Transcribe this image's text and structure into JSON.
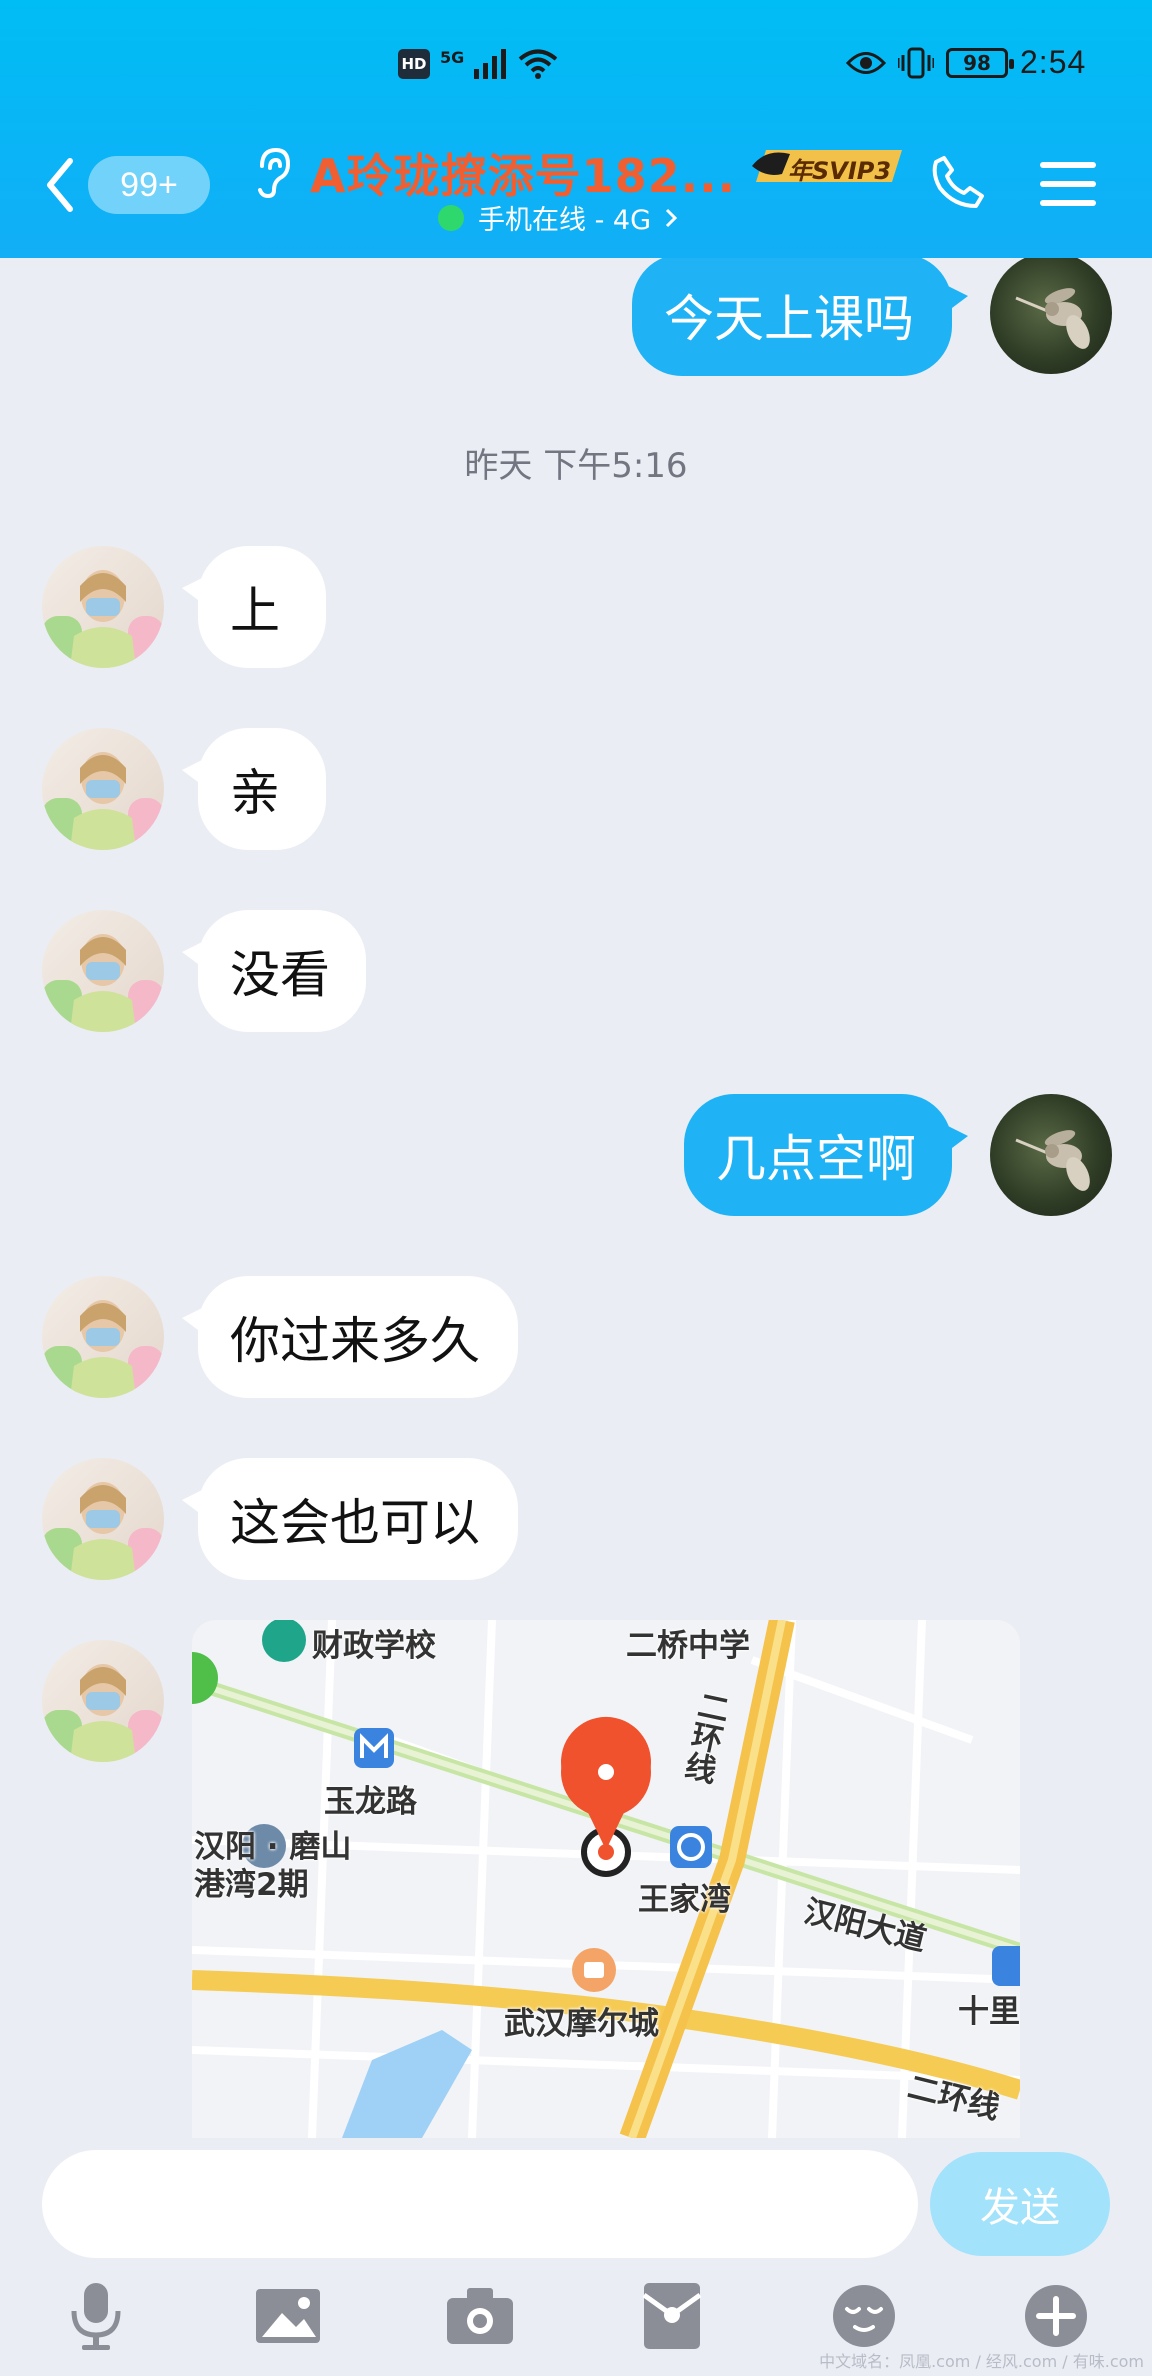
{
  "status_bar": {
    "network": "5G",
    "battery": "98",
    "time": "2:54"
  },
  "header": {
    "unread_count": "99+",
    "contact_name": "A玲珑撩添号182...",
    "vip_badge": "年SVIP3",
    "online_status": "手机在线 - 4G",
    "colors": {
      "header_bg": "#12aef6",
      "name": "#f05f31"
    }
  },
  "chat": {
    "timestamp": "昨天 下午5:16",
    "messages": [
      {
        "from": "me",
        "text": "今天上课吗"
      },
      {
        "from": "contact",
        "text": "上"
      },
      {
        "from": "contact",
        "text": "亲"
      },
      {
        "from": "contact",
        "text": "没看"
      },
      {
        "from": "me",
        "text": "几点空啊"
      },
      {
        "from": "contact",
        "text": "你过来多久"
      },
      {
        "from": "contact",
        "text": "这会也可以"
      }
    ],
    "map": {
      "labels": {
        "school": "财政学校",
        "middle_school": "二桥中学",
        "ring_road_1": "二环线",
        "metro_station": "玉龙路",
        "area": "汉阳 · 磨山港湾2期",
        "interchange": "王家湾",
        "avenue": "汉阳大道",
        "mall": "武汉摩尔城",
        "partial_right": "十里",
        "ring_road_2": "二环线"
      }
    }
  },
  "composer": {
    "input_value": "",
    "send_label": "发送"
  },
  "toolbar": {
    "icons": [
      "microphone-icon",
      "image-icon",
      "camera-icon",
      "red-packet-icon",
      "emoji-icon",
      "plus-icon"
    ]
  },
  "watermark": "中文域名：凤凰.com / 经风.com / 有味.com"
}
